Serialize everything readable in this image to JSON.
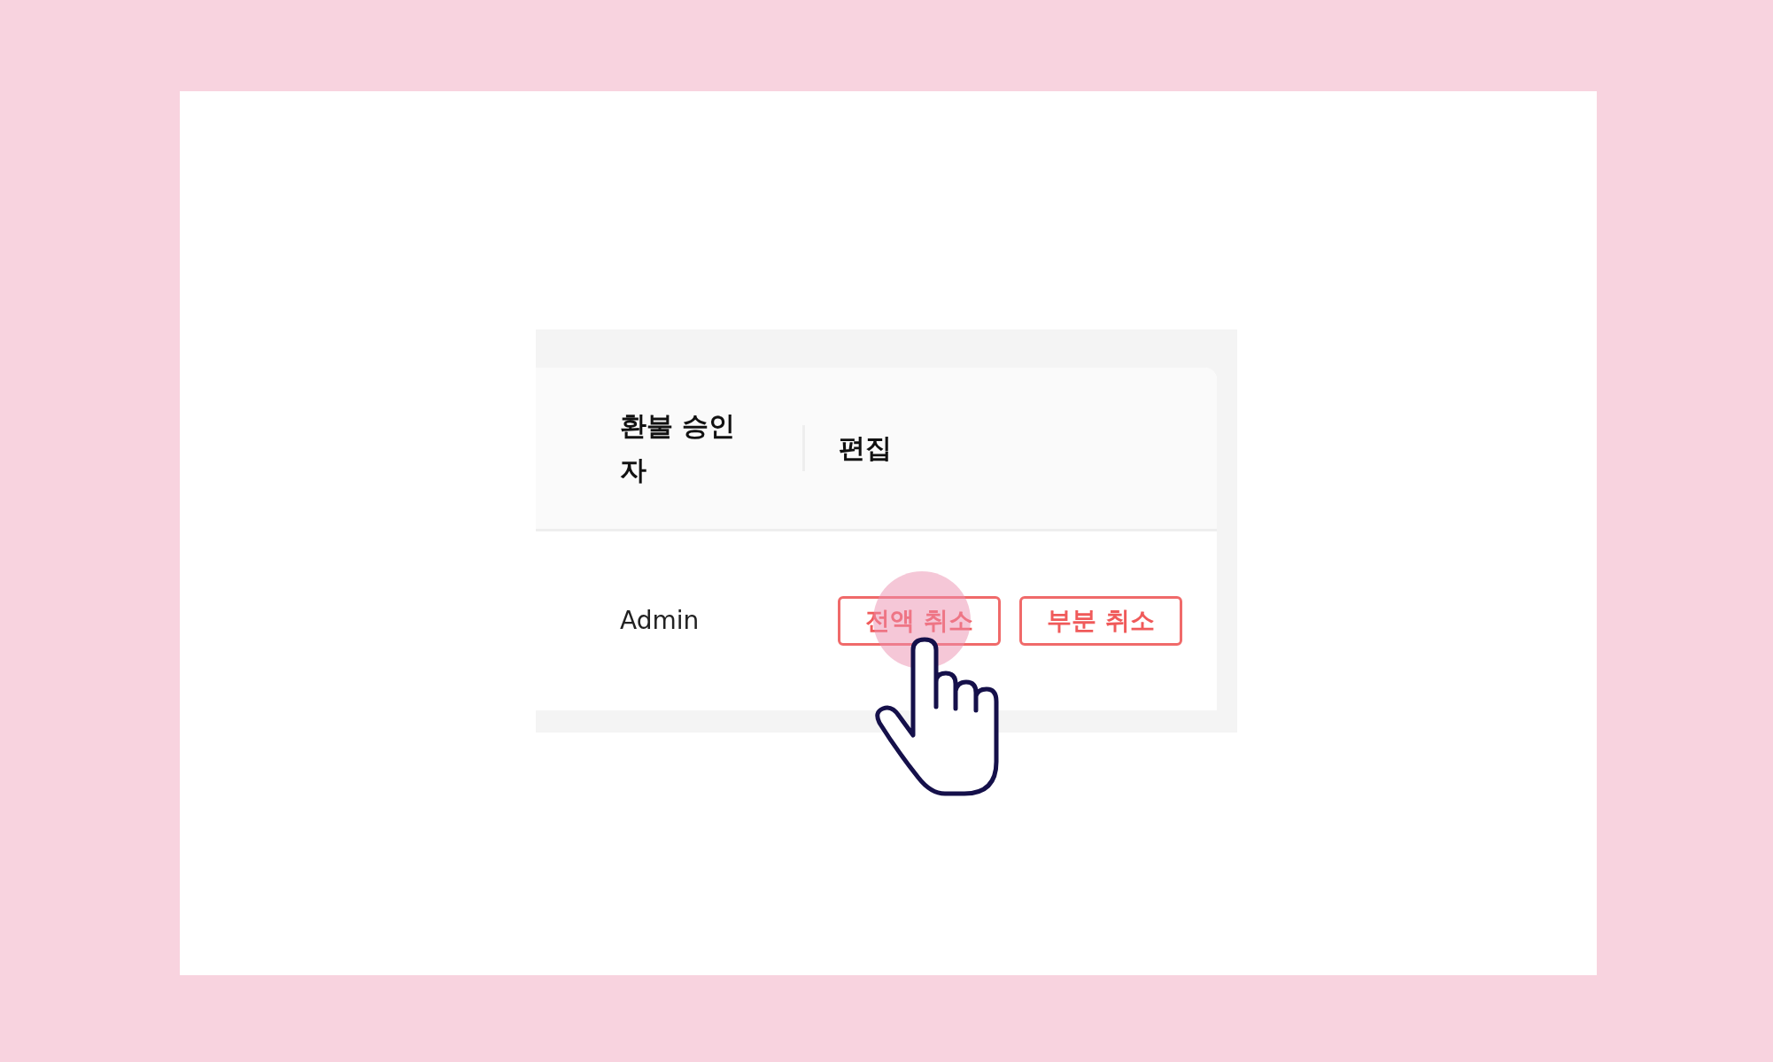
{
  "table": {
    "columns": [
      {
        "label": "환불 승인\n자"
      },
      {
        "label": "편집"
      }
    ],
    "rows": [
      {
        "approver": "Admin",
        "actions": [
          {
            "label": "전액 취소"
          },
          {
            "label": "부분 취소"
          }
        ]
      }
    ]
  }
}
